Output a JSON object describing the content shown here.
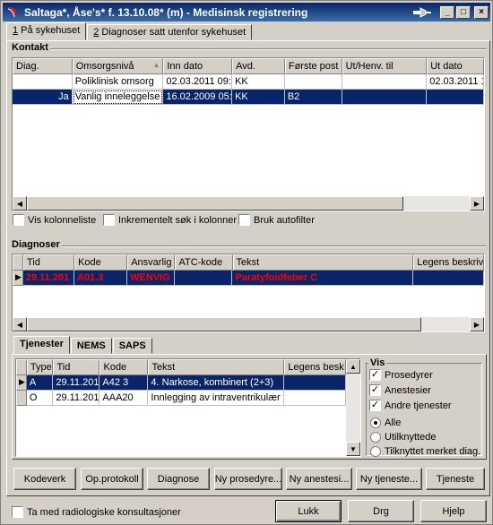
{
  "window": {
    "title": "Saltaga*, Åse's* f. 13.10.08* (m) - Medisinsk registrering",
    "controls": {
      "minimize": "_",
      "maximize": "□",
      "close": "×"
    }
  },
  "main_tabs": [
    {
      "prefix": "1",
      "label": " På sykehuset"
    },
    {
      "prefix": "2",
      "label": " Diagnoser satt utenfor sykehuset"
    }
  ],
  "kontakt": {
    "title": "Kontakt",
    "columns": [
      "Diag.",
      "Omsorgsnivå",
      "Inn dato",
      "Avd.",
      "Første post",
      "Ut/Henv. til",
      "Ut dato"
    ],
    "sort_indicator": "▲",
    "rows": [
      [
        "",
        "Poliklinisk omsorg",
        "02.03.2011 09:",
        "KK",
        "",
        "",
        "02.03.2011 1"
      ],
      [
        "Ja",
        "Vanlig inneleggelse",
        "16.02.2009 05:",
        "KK",
        "B2",
        "",
        ""
      ]
    ],
    "options": [
      {
        "label": "Vis kolonneliste",
        "checked": false
      },
      {
        "label": "Inkrementelt søk i kolonner",
        "checked": false
      },
      {
        "label": "Bruk autofilter",
        "checked": false
      }
    ]
  },
  "diagnoser": {
    "title": "Diagnoser",
    "columns": [
      "Tid",
      "Kode",
      "Ansvarlig",
      "ATC-kode",
      "Tekst",
      "Legens beskriv"
    ],
    "rows": [
      [
        "29.11.201",
        "A01.3",
        "WENVIG",
        "",
        "Paratyfoidfeber C",
        ""
      ]
    ]
  },
  "sub_tabs": [
    {
      "label": "Tjenester",
      "underline": "r"
    },
    {
      "label": "NEMS",
      "underline": "M"
    },
    {
      "label": "SAPS",
      "underline": "P"
    }
  ],
  "tjenester": {
    "columns": [
      "Type",
      "Tid",
      "Kode",
      "Tekst",
      "Legens besk"
    ],
    "rows": [
      [
        "A",
        "29.11.201",
        "A42 3",
        "4. Narkose, kombinert (2+3)",
        ""
      ],
      [
        "O",
        "29.11.201",
        "AAA20",
        "Innlegging av intraventrikulær try",
        ""
      ]
    ]
  },
  "vis": {
    "title": "Vis",
    "checkboxes": [
      {
        "label": "Prosedyrer",
        "checked": true
      },
      {
        "label": "Anestesier",
        "checked": true
      },
      {
        "label": "Andre tjenester",
        "checked": true
      }
    ],
    "radios": [
      {
        "label": "Alle",
        "selected": true
      },
      {
        "label": "Utilknyttede",
        "selected": false
      },
      {
        "label": "Tilknyttet merket diag.",
        "selected": false
      }
    ]
  },
  "action_buttons": [
    "Kodeverk",
    "Op.protokoll",
    "Diagnose",
    "Ny prosedyre...",
    "Ny anestesi...",
    "Ny tjeneste...",
    "Tjeneste"
  ],
  "footer": {
    "radiology_label": "Ta med radiologiske konsultasjoner",
    "radiology_checked": false,
    "lukk": "Lukk",
    "drg": "Drg",
    "hjelp": "Hjelp"
  },
  "colors": {
    "title_bar": "#0a246a",
    "selection": "#0a246a",
    "diagnosis_text": "#ff0000",
    "face": "#d4d0c8"
  }
}
